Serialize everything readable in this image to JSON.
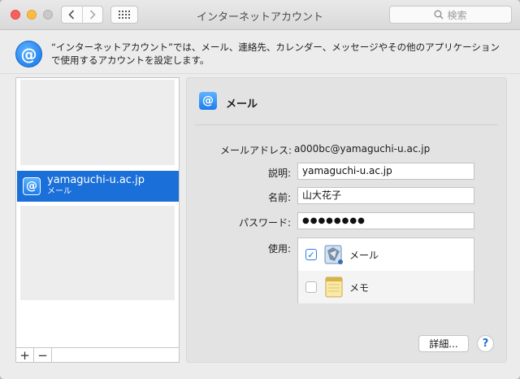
{
  "window": {
    "title": "インターネットアカウント"
  },
  "toolbar": {
    "search_placeholder": "検索"
  },
  "header": {
    "description_line1": "“インターネットアカウント”では、メール、連絡先、カレンダー、メッセージやその他のアプリケーション",
    "description_line2": "で使用するアカウントを設定します。"
  },
  "accounts": [
    {
      "name": "yamaguchi-u.ac.jp",
      "type": "メール",
      "selected": true
    }
  ],
  "list_footer": {
    "add_label": "+",
    "remove_label": "−"
  },
  "detail": {
    "service_title": "メール",
    "email_label": "メールアドレス:",
    "email_value": "a000bc@yamaguchi-u.ac.jp",
    "description_label": "説明:",
    "description_value": "yamaguchi-u.ac.jp",
    "name_label": "名前:",
    "name_value": "山大花子",
    "password_label": "パスワード:",
    "password_value": "●●●●●●●●",
    "usage_label": "使用:",
    "usage_apps": [
      {
        "label": "メール",
        "checked": true,
        "icon": "mail-app-icon"
      },
      {
        "label": "メモ",
        "checked": false,
        "icon": "notes-app-icon"
      }
    ],
    "details_button": "詳細...",
    "help_button": "?"
  },
  "colors": {
    "selection": "#1a6fd9",
    "close": "#fc605c",
    "minimize": "#fdbc40",
    "zoom": "#c9c9c9"
  }
}
